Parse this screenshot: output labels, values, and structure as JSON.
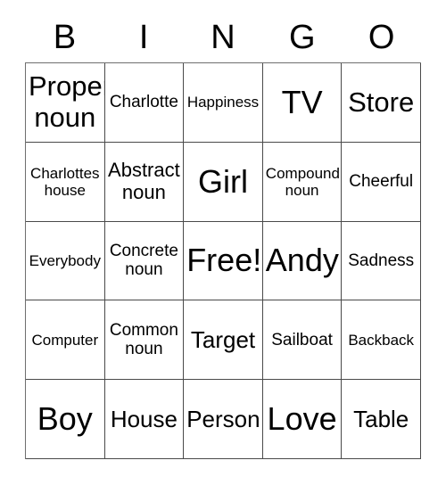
{
  "card": {
    "type": "bingo-card",
    "columns": 5,
    "rows": 5,
    "background_color": "#ffffff",
    "text_color": "#000000",
    "grid_line_color": "#4a4a4a"
  },
  "header": {
    "letters": [
      {
        "label": "B"
      },
      {
        "label": "I"
      },
      {
        "label": "N"
      },
      {
        "label": "G"
      },
      {
        "label": "O"
      }
    ]
  },
  "grid": {
    "cells": [
      {
        "text": "Proper noun",
        "size": "fs-xxl"
      },
      {
        "text": "Charlotte",
        "size": "fs-md"
      },
      {
        "text": "Happiness",
        "size": "fs-sm"
      },
      {
        "text": "TV",
        "size": "fs-huge"
      },
      {
        "text": "Store",
        "size": "fs-xxl"
      },
      {
        "text": "Charlottes house",
        "size": "fs-sm"
      },
      {
        "text": "Abstract noun",
        "size": "fs-lg"
      },
      {
        "text": "Girl",
        "size": "fs-huge"
      },
      {
        "text": "Compound noun",
        "size": "fs-sm"
      },
      {
        "text": "Cheerful",
        "size": "fs-md"
      },
      {
        "text": "Everybody",
        "size": "fs-sm"
      },
      {
        "text": "Concrete noun",
        "size": "fs-md"
      },
      {
        "text": "Free!",
        "size": "fs-huge"
      },
      {
        "text": "Andy",
        "size": "fs-huge"
      },
      {
        "text": "Sadness",
        "size": "fs-md"
      },
      {
        "text": "Computer",
        "size": "fs-sm"
      },
      {
        "text": "Common noun",
        "size": "fs-md"
      },
      {
        "text": "Target",
        "size": "fs-xl"
      },
      {
        "text": "Sailboat",
        "size": "fs-md"
      },
      {
        "text": "Backback",
        "size": "fs-sm"
      },
      {
        "text": "Boy",
        "size": "fs-huge"
      },
      {
        "text": "House",
        "size": "fs-xl"
      },
      {
        "text": "Person",
        "size": "fs-xl"
      },
      {
        "text": "Love",
        "size": "fs-huge"
      },
      {
        "text": "Table",
        "size": "fs-xl"
      }
    ]
  }
}
